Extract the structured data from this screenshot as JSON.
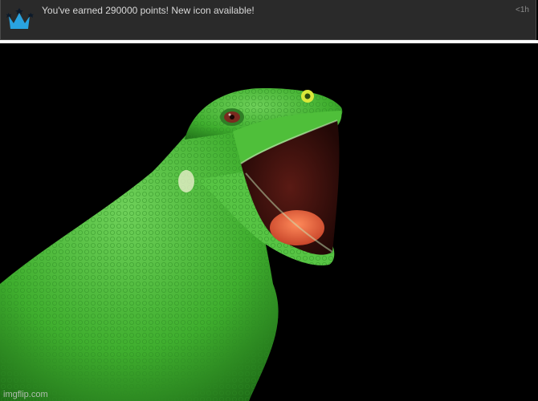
{
  "notification": {
    "icon": "crown-icon",
    "icon_color": "#29a3e0",
    "message": "You've earned 290000 points! New icon available!",
    "time": "<1h"
  },
  "image": {
    "subject": "green lizard with open mouth",
    "background_color": "#000000",
    "watermark": "imgflip.com"
  }
}
